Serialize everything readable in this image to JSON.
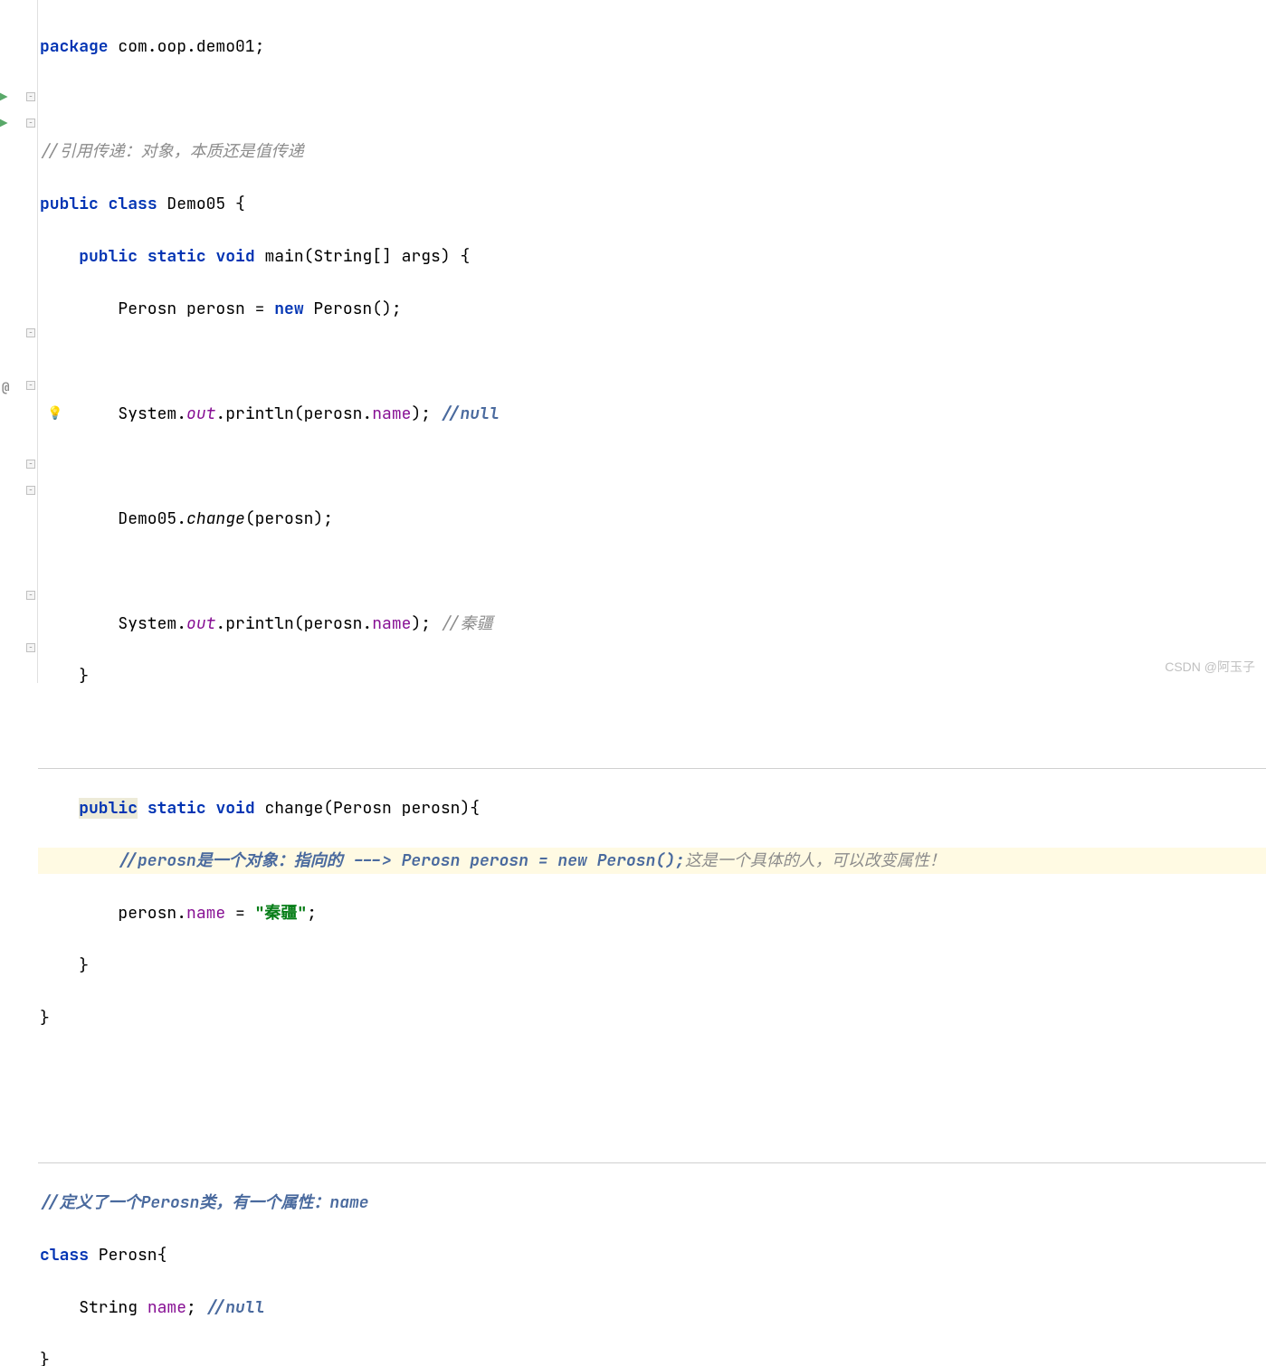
{
  "code": {
    "package_kw": "package",
    "package_name": " com.oop.demo01;",
    "comment1": "//引用传递：对象，本质还是值传递",
    "public_kw": "public",
    "class_kw": "class",
    "class_name": " Demo05 {",
    "static_kw": "static",
    "void_kw": "void",
    "main_sig": " main(String[] args) {",
    "perosn_decl_type": "Perosn ",
    "perosn_decl_var": "perosn = ",
    "new_kw": "new",
    "perosn_ctor": " Perosn();",
    "system": "System.",
    "out": "out",
    "println": ".println(perosn.",
    "name_field": "name",
    "close_paren": "); ",
    "comment_null": "//null",
    "demo05_call": "Demo05.",
    "change_call": "change",
    "change_args": "(perosn);",
    "comment_qinjiang": "//秦疆",
    "close_brace1": "    }",
    "change_sig": " change(Perosn perosn){",
    "comment2_a": "//perosn是一个对象：指向的 ---> Perosn perosn = new Perosn();",
    "comment2_b": "这是一个具体的人，可以改变属性！",
    "assign_prefix": "perosn.",
    "assign_eq": " = ",
    "string_val": "\"秦疆\"",
    "semicolon": ";",
    "close_brace2": "    }",
    "close_brace3": "}",
    "comment3": "//定义了一个Perosn类，有一个属性：name",
    "class_perosn": " Perosn{",
    "string_type": "String ",
    "name_decl": "name",
    "name_decl_end": "; ",
    "close_brace4": "}"
  },
  "watermark": "CSDN @阿玉子"
}
